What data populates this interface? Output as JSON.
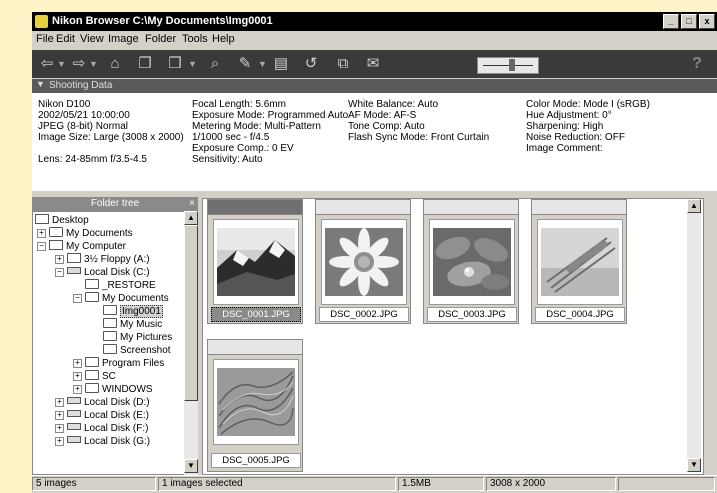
{
  "window": {
    "title": "Nikon Browser C:\\My Documents\\Img0001",
    "minimize": "_",
    "maximize": "□",
    "close": "x"
  },
  "menu": [
    "File",
    "Edit",
    "View",
    "Image",
    "Folder",
    "Tools",
    "Help"
  ],
  "toolbar": {
    "icons": [
      "back-arrow-icon",
      "forward-arrow-icon",
      "up-folder-icon",
      "new-folder-icon",
      "copy-folder-icon",
      "open-folder-icon",
      "edit-pen-icon",
      "print-doc-icon",
      "rotate-icon",
      "copy-icon",
      "mail-icon",
      "thumbnail-size-slider"
    ],
    "help": "?",
    "slider_level": 0.6
  },
  "shooting": {
    "header": "Shooting Data",
    "col1": [
      "Nikon D100",
      "2002/05/21 10:00:00",
      "JPEG (8-bit) Normal",
      "Image Size:  Large (3008 x 2000)",
      "",
      "Lens: 24-85mm f/3.5-4.5"
    ],
    "col2": [
      "Focal Length: 5.6mm",
      "Exposure Mode: Programmed Auto",
      "Metering Mode: Multi-Pattern",
      "1/1000 sec - f/4.5",
      "Exposure Comp.: 0 EV",
      "Sensitivity: Auto"
    ],
    "col3": [
      "White Balance: Auto",
      "AF Mode: AF-S",
      "Tone Comp: Auto",
      "Flash Sync Mode: Front Curtain"
    ],
    "col4": [
      "Color Mode: Mode I (sRGB)",
      "Hue Adjustment: 0°",
      "Sharpening: High",
      "Noise Reduction: OFF",
      "Image Comment:"
    ]
  },
  "folder_tree": {
    "header": "Folder tree",
    "close": "×",
    "items": [
      {
        "label": "Desktop",
        "icon": "desktop-icon",
        "expander": ""
      },
      {
        "label": "My Documents",
        "icon": "my-documents-icon",
        "expander": "+"
      },
      {
        "label": "My Computer",
        "icon": "my-computer-icon",
        "expander": "−"
      },
      {
        "label": "3½ Floppy (A:)",
        "icon": "floppy-icon",
        "expander": "+"
      },
      {
        "label": "Local Disk (C:)",
        "icon": "drive-icon",
        "expander": "−"
      },
      {
        "label": "_RESTORE",
        "icon": "folder-icon",
        "expander": ""
      },
      {
        "label": "My Documents",
        "icon": "folder-icon",
        "expander": "−"
      },
      {
        "label": "Img0001",
        "icon": "folder-icon",
        "expander": ""
      },
      {
        "label": "My Music",
        "icon": "folder-icon",
        "expander": ""
      },
      {
        "label": "My Pictures",
        "icon": "folder-icon",
        "expander": ""
      },
      {
        "label": "Screenshot",
        "icon": "folder-icon",
        "expander": ""
      },
      {
        "label": "Program Files",
        "icon": "folder-icon",
        "expander": "+"
      },
      {
        "label": "SC",
        "icon": "folder-icon",
        "expander": "+"
      },
      {
        "label": "WINDOWS",
        "icon": "folder-icon",
        "expander": "+"
      },
      {
        "label": "Local Disk (D:)",
        "icon": "drive-icon",
        "expander": "+"
      },
      {
        "label": "Local Disk (E:)",
        "icon": "drive-icon",
        "expander": "+"
      },
      {
        "label": "Local Disk (F:)",
        "icon": "drive-icon",
        "expander": "+"
      },
      {
        "label": "Local Disk (G:)",
        "icon": "drive-icon",
        "expander": "+"
      }
    ]
  },
  "thumbnails": [
    {
      "name": "DSC_0001.JPG",
      "subject": "mountain-landscape",
      "selected": true
    },
    {
      "name": "DSC_0002.JPG",
      "subject": "daisy-flower",
      "selected": false
    },
    {
      "name": "DSC_0003.JPG",
      "subject": "water-drop-leaf",
      "selected": false
    },
    {
      "name": "DSC_0004.JPG",
      "subject": "wheat-field",
      "selected": false
    },
    {
      "name": "DSC_0005.JPG",
      "subject": "grass-texture",
      "selected": false
    }
  ],
  "status": {
    "count": "5 images",
    "selected": "1 images selected",
    "size": "1.5MB",
    "dimensions": "3008 x 2000"
  }
}
